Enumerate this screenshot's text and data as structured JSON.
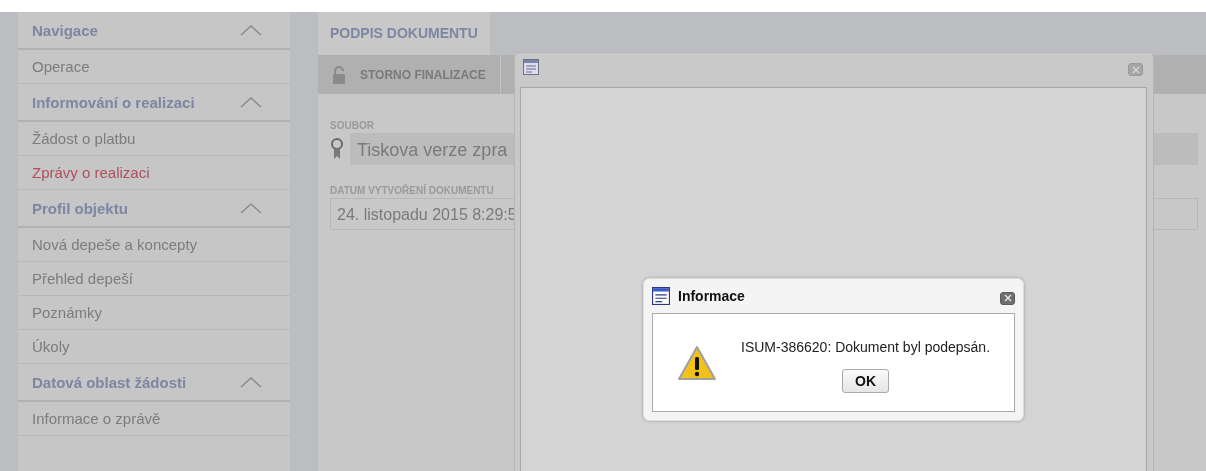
{
  "sidebar": {
    "sections": [
      {
        "title": "Navigace",
        "expanded": true,
        "items": [
          {
            "label": "Operace",
            "selected": false
          }
        ]
      },
      {
        "title": "Informování o realizaci",
        "expanded": true,
        "items": [
          {
            "label": "Žádost o platbu",
            "selected": false
          },
          {
            "label": "Zprávy o realizaci",
            "selected": true
          }
        ]
      },
      {
        "title": "Profil objektu",
        "expanded": true,
        "items": [
          {
            "label": "Nová depeše a koncepty",
            "selected": false
          },
          {
            "label": "Přehled depeší",
            "selected": false
          },
          {
            "label": "Poznámky",
            "selected": false
          },
          {
            "label": "Úkoly",
            "selected": false
          }
        ]
      },
      {
        "title": "Datová oblast žádosti",
        "expanded": true,
        "items": [
          {
            "label": "Informace o zprávě",
            "selected": false
          }
        ]
      }
    ]
  },
  "tab": {
    "label": "PODPIS DOKUMENTU"
  },
  "toolbar": {
    "buttons": [
      {
        "label": "STORNO FINALIZACE"
      }
    ]
  },
  "fields": [
    {
      "label": "SOUBOR",
      "value": "Tiskova verze zpra",
      "kind": "file"
    },
    {
      "label": "DATUM VYTVOŘENÍ DOKUMENTU",
      "value": "24. listopadu 2015 8:29:5",
      "kind": "text"
    }
  ],
  "message_box": {
    "title": "Informace",
    "message": "ISUM-386620: Dokument byl podepsán.",
    "button": "OK"
  }
}
